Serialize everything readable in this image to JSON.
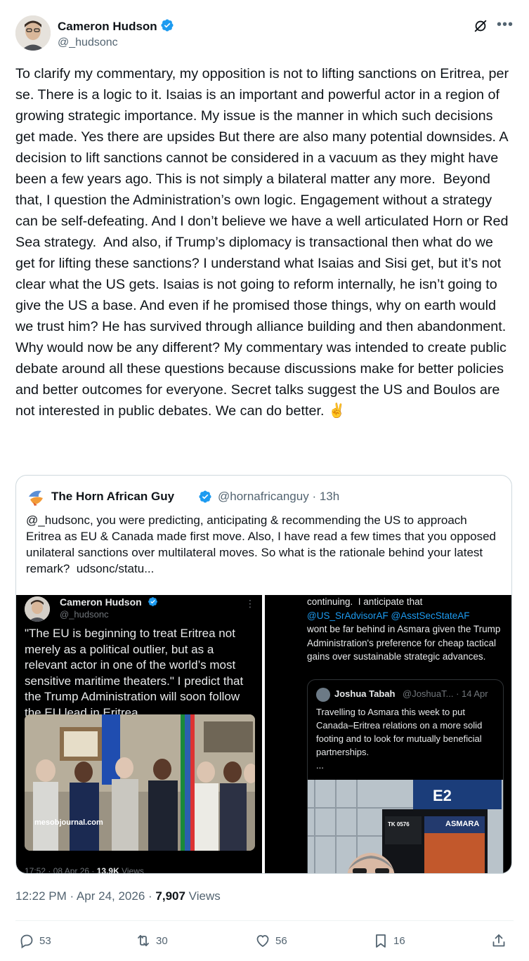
{
  "author": {
    "name": "Cameron Hudson",
    "handle": "@_hudsonc"
  },
  "tweet": {
    "text": "To clarify my commentary, my opposition is not to lifting sanctions on Eritrea, per se. There is a logic to it. Isaias is an important and powerful actor in a region of growing strategic importance. My issue is the manner in which such decisions get made. Yes there are upsides But there are also many potential downsides. A decision to lift sanctions cannot be considered in a vacuum as they might have been a few years ago. This is not simply a bilateral matter any more.  Beyond that, I question the Administration’s own logic. Engagement without a strategy can be self-defeating. And I don’t believe we have a well articulated Horn or Red Sea strategy.  And also, if Trump’s diplomacy is transactional then what do we get for lifting these sanctions? I understand what Isaias and Sisi get, but it’s not clear what the US gets. Isaias is not going to reform internally, he isn’t going to give the US a base. And even if he promised those things, why on earth would we trust him? He has survived through alliance building and then abandonment. Why would now be any different? My commentary was intended to create public debate around all these questions because discussions make for better policies and better outcomes for everyone. Secret talks suggest the US and Boulos are not interested in public debates. We can do better. ✌️",
    "timestamp": "12:22 PM · Apr 24, 2026 · ",
    "views_count": "7,907",
    "views_label": " Views"
  },
  "quoted_tweet": {
    "name": "The Horn African Guy",
    "handle_time": "@hornafricanguy · 13h",
    "text": "@_hudsonc, you were predicting, anticipating & recommending the US to approach Eritrea as EU & Canada made first move. Also, I have read a few times that you opposed unilateral sanctions over multilateral moves. So what is the rationale behind your latest remark?  udsonc/statu...",
    "left_panel": {
      "name": "Cameron Hudson",
      "handle": "@_hudsonc",
      "text": "\"The EU is beginning to treat Eritrea not merely as a political outlier, but as a relevant actor in one of the world’s most sensitive maritime theaters.\" I predict that the Trump Administration will soon follow the EU lead in Eritrea...",
      "watermark": "mesobjournal.com",
      "meta_time": "17:52 · 08 Apr 26 · ",
      "meta_views_count": "13.9K",
      "meta_views_label": " Views"
    },
    "right_panel": {
      "text_top": "continuing.  I anticipate that",
      "mention_1": "@US_SrAdvisorAF",
      "mention_2": "@AsstSecStateAF",
      "text_bottom": "wont be far behind in Asmara given the Trump Administration's preference for cheap tactical gains over sustainable strategic advances.",
      "inner": {
        "name": "Joshua Tabah",
        "handle_date": "@JoshuaT... · 14 Apr",
        "text": "Travelling to Asmara this week to put Canada–Eritrea relations on a more solid footing and to look for mutually beneficial partnerships.\n...",
        "sign_gate": "E2",
        "sign_city": "ASMARA",
        "sign_flight": "TK 0576"
      }
    }
  },
  "actions": {
    "replies": "53",
    "reposts": "30",
    "likes": "56",
    "bookmarks": "16"
  },
  "colors": {
    "text": "#0f1419",
    "secondary": "#536471",
    "verified": "#1d9bf0",
    "border": "#cfd9de"
  }
}
